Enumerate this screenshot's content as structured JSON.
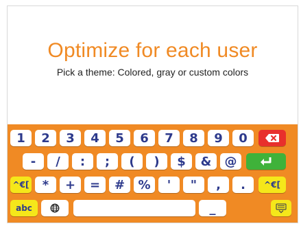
{
  "header": {
    "title": "Optimize for each user",
    "subtitle": "Pick a theme: Colored, gray or custom colors"
  },
  "colors": {
    "accent": "#f08a24",
    "keyboard_bg": "#f08a24",
    "key_bg": "#ffffff",
    "key_text": "#2d3a8c",
    "special_key": "#f5e71a",
    "delete_key": "#e8302c",
    "enter_key": "#3fb23a"
  },
  "keyboard": {
    "row1": [
      "1",
      "2",
      "3",
      "4",
      "5",
      "6",
      "7",
      "8",
      "9",
      "0"
    ],
    "row2": [
      "-",
      "/",
      ":",
      ";",
      "(",
      ")",
      "$",
      "&",
      "@"
    ],
    "row3": [
      "*",
      "+",
      "=",
      "#",
      "%",
      "'",
      "\"",
      ",",
      "."
    ],
    "switch_left_label": "^€[",
    "switch_right_label": "^€[",
    "abc_label": "abc",
    "space_label": "",
    "underscore_label": "_",
    "icons": {
      "delete": "backspace-icon",
      "enter": "enter-icon",
      "globe": "globe-icon",
      "hide": "hide-keyboard-icon"
    }
  }
}
